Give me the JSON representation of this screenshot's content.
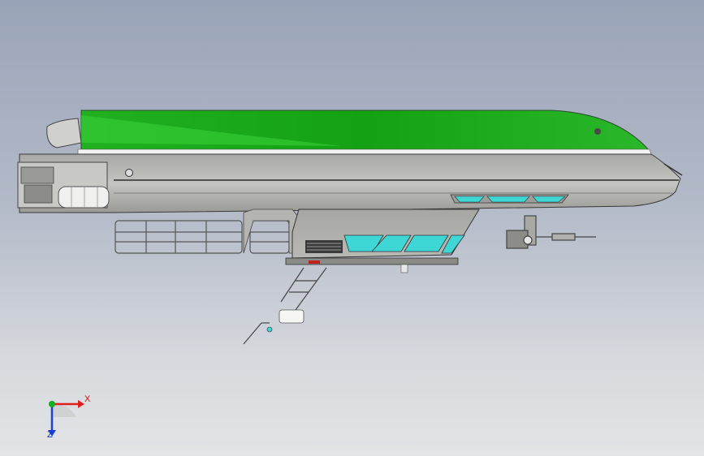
{
  "triad": {
    "x_label": "X",
    "z_label": "Z",
    "colors": {
      "x": "#e02020",
      "y": "#10b020",
      "z": "#2040d0"
    }
  },
  "model": {
    "hull_color": "#b9b9b6",
    "canopy_color": "#1ea81e",
    "window_color": "#3fd6d6",
    "icons": [
      "airship-hull-model",
      "gondola",
      "railing",
      "propeller-engine",
      "fuel-tank",
      "landing-gear"
    ]
  }
}
